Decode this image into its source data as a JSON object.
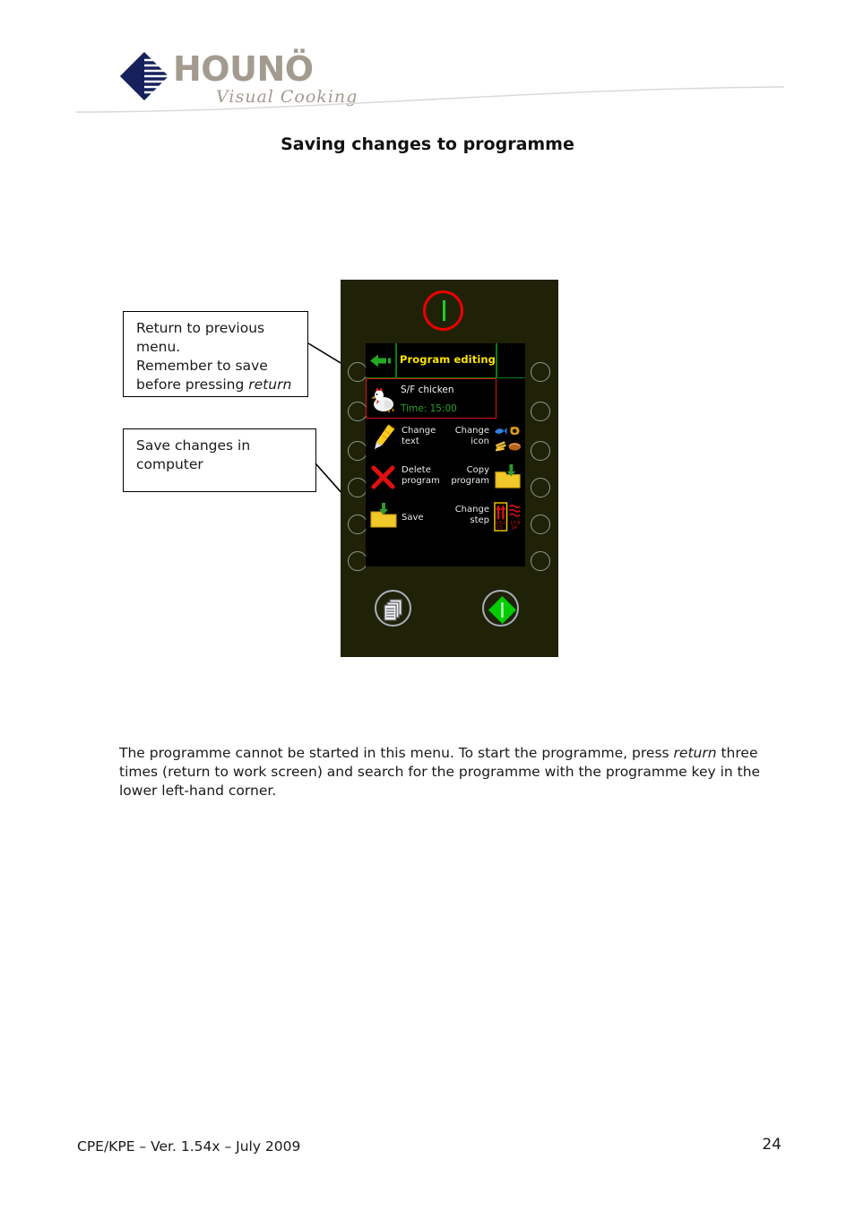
{
  "document": {
    "brand": {
      "name": "HOUNÖ",
      "tagline": "Visual Cooking",
      "logo_icon": "houno-arrow-logo",
      "brand_color": "#a39b8f",
      "mark_color": "#16215c"
    },
    "title": "Saving changes to programme",
    "body_paragraph_part1": "The programme cannot be started in this menu. To start the programme, press ",
    "body_paragraph_emphasis": "return",
    "body_paragraph_part2": " three times (return to work screen) and search for the programme with the programme key in the lower left-hand corner.",
    "footer": {
      "left": "CPE/KPE – Ver. 1.54x – July 2009",
      "page_number": "24"
    }
  },
  "callouts": [
    {
      "id": "return-callout",
      "line1": "Return to previous",
      "line2": "menu.",
      "line3": "Remember to save",
      "line4_prefix": "before pressing ",
      "line4_emphasis": "return"
    },
    {
      "id": "save-callout",
      "line1": "Save changes in",
      "line2": "computer"
    }
  ],
  "panel": {
    "panel_color": "#202208",
    "power_indicator": {
      "icon": "power-standby-icon",
      "ring_color": "#ee0000",
      "bar_color": "#22cc22"
    },
    "screen": {
      "background": "#000000",
      "title": "Program editing",
      "title_color": "#ffe400",
      "back_icon": "back-arrow-icon",
      "back_icon_color": "#22aa22",
      "selected_program": {
        "icon": "chicken-icon",
        "name": "S/F chicken",
        "time_label": "Time: 15:00",
        "highlight_color": "#e01010",
        "time_color": "#24a524"
      },
      "menu_rows": [
        {
          "left_icon": "change-text-pen-icon",
          "left_label_line1": "Change",
          "left_label_line2": "text",
          "right_label_line1": "Change",
          "right_label_line2": "icon",
          "right_icon": "food-icons-grid-icon"
        },
        {
          "left_icon": "delete-cross-icon",
          "left_label_line1": "Delete",
          "left_label_line2": "program",
          "right_label_line1": "Copy",
          "right_label_line2": "program",
          "right_icon": "copy-folder-icon"
        },
        {
          "left_icon": "save-folder-icon",
          "left_label_line1": "Save",
          "left_label_line2": "",
          "right_label_line1": "Change",
          "right_label_line2": "step",
          "right_icon": "change-step-icon"
        }
      ]
    },
    "side_keys": {
      "left_count": 6,
      "right_count": 6,
      "ring_color": "#8e9a8e"
    },
    "bottom_buttons": [
      {
        "name": "programme-key-button",
        "icon": "stacked-pages-icon"
      },
      {
        "name": "start-button",
        "icon": "green-diamond-start-icon",
        "color": "#00cc00"
      }
    ]
  }
}
